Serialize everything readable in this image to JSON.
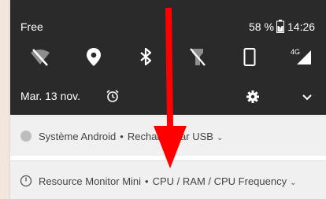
{
  "status_bar": {
    "carrier": "Free",
    "battery_percent": "58 %",
    "time": "14:26"
  },
  "quick_tiles": [
    {
      "name": "wifi-off-icon"
    },
    {
      "name": "location-icon"
    },
    {
      "name": "bluetooth-icon"
    },
    {
      "name": "flashlight-off-icon"
    },
    {
      "name": "screen-rotation-icon"
    },
    {
      "name": "mobile-data-4g-icon",
      "label": "4G"
    }
  ],
  "date_row": {
    "date": "Mar. 13 nov.",
    "alarm_icon": "alarm-clock-icon",
    "settings_icon": "gear-icon",
    "expand_icon": "chevron-down-icon"
  },
  "notifications": [
    {
      "app": "Système Android",
      "separator": "•",
      "summary": "Recharge par USB"
    },
    {
      "app": "Resource Monitor Mini",
      "separator": "•",
      "summary": "CPU / RAM / CPU Frequency"
    }
  ],
  "colors": {
    "shade_dark": "#2a2a2a",
    "notification_bg": "#f0f0f0",
    "arrow_red": "#ff0000"
  },
  "annotation": {
    "type": "red-arrow",
    "direction": "down",
    "icon": "red-arrow-annotation"
  }
}
